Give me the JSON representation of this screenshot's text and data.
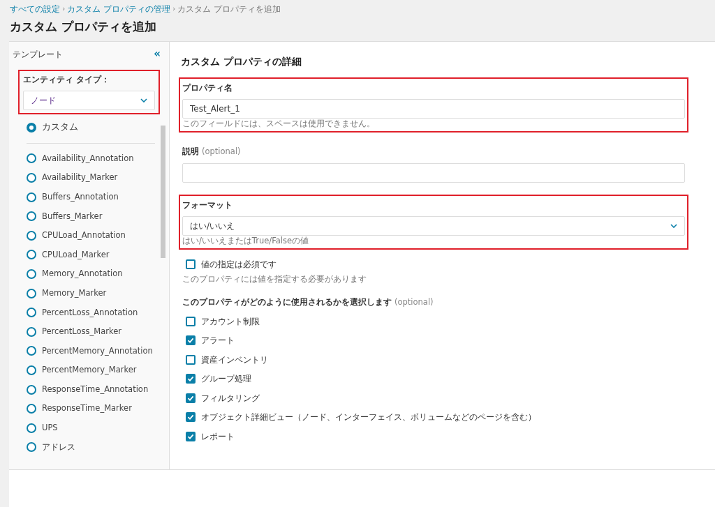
{
  "breadcrumb": [
    {
      "label": "すべての設定",
      "link": true,
      "separator": "›"
    },
    {
      "label": "カスタム プロパティの管理",
      "link": true,
      "separator": "›"
    },
    {
      "label": "カスタム プロパティを追加",
      "link": false
    }
  ],
  "page_title": "カスタム プロパティを追加",
  "sidebar": {
    "title": "テンプレート",
    "collapse_icon": "«",
    "entity_type": {
      "label": "エンティティ タイプ：",
      "value": "ノード",
      "highlighted": true
    },
    "templates": [
      {
        "label": "カスタム",
        "selected": true
      },
      {
        "label": "Availability_Annotation",
        "selected": false
      },
      {
        "label": "Availability_Marker",
        "selected": false
      },
      {
        "label": "Buffers_Annotation",
        "selected": false
      },
      {
        "label": "Buffers_Marker",
        "selected": false
      },
      {
        "label": "CPULoad_Annotation",
        "selected": false
      },
      {
        "label": "CPULoad_Marker",
        "selected": false
      },
      {
        "label": "Memory_Annotation",
        "selected": false
      },
      {
        "label": "Memory_Marker",
        "selected": false
      },
      {
        "label": "PercentLoss_Annotation",
        "selected": false
      },
      {
        "label": "PercentLoss_Marker",
        "selected": false
      },
      {
        "label": "PercentMemory_Annotation",
        "selected": false
      },
      {
        "label": "PercentMemory_Marker",
        "selected": false
      },
      {
        "label": "ResponseTime_Annotation",
        "selected": false
      },
      {
        "label": "ResponseTime_Marker",
        "selected": false
      },
      {
        "label": "UPS",
        "selected": false
      },
      {
        "label": "アドレス",
        "selected": false
      }
    ]
  },
  "details": {
    "title": "カスタム プロパティの詳細",
    "fields": [
      {
        "kind": "text",
        "label": "プロパティ名",
        "value": "Test_Alert_1",
        "hint": "このフィールドには、スペースは使用できません。",
        "highlighted": true
      },
      {
        "kind": "text",
        "label": "説明",
        "optional": "(optional)",
        "highlighted": false
      },
      {
        "kind": "select",
        "label": "フォーマット",
        "value": "はい/いいえ",
        "hint": "はい/いいえまたはTrue/Falseの値",
        "highlighted": true
      }
    ],
    "required": {
      "label": "値の指定は必須です",
      "checked": false,
      "hint": "このプロパティには値を指定する必要があります"
    },
    "usage": {
      "label": "このプロパティがどのように使用されるかを選択します",
      "optional": "(optional)",
      "options": [
        {
          "label": "アカウント制限",
          "checked": false
        },
        {
          "label": "アラート",
          "checked": true
        },
        {
          "label": "資産インベントリ",
          "checked": false
        },
        {
          "label": "グループ処理",
          "checked": true
        },
        {
          "label": "フィルタリング",
          "checked": true
        },
        {
          "label": "オブジェクト詳細ビュー（ノード、インターフェイス、ボリュームなどのページを含む）",
          "checked": true
        },
        {
          "label": "レポート",
          "checked": true
        }
      ]
    }
  }
}
